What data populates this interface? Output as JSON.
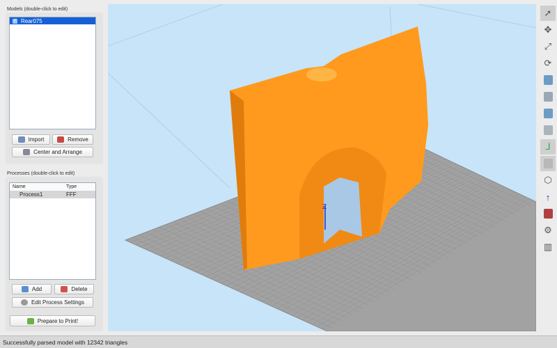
{
  "models": {
    "title": "Models (double-click to edit)",
    "items": [
      {
        "name": "Rear075",
        "checked": true
      }
    ],
    "import": "Import",
    "remove": "Remove",
    "center": "Center and Arrange"
  },
  "processes": {
    "title": "Processes (double-click to edit)",
    "columns": [
      "Name",
      "Type"
    ],
    "rows": [
      {
        "name": "Process1",
        "type": "FFF"
      }
    ],
    "add": "Add",
    "delete": "Delete",
    "edit": "Edit Process Settings",
    "prepare": "Prepare to Print!"
  },
  "viewport": {
    "axis_label": "Z",
    "model_color": "#ff9a1e",
    "bed_color": "#a0a0a0",
    "background": "#c8e4f8"
  },
  "toolbar": [
    "select-icon",
    "move-icon",
    "scale-icon",
    "rotate-icon",
    "view-top-icon",
    "view-front-icon",
    "view-side-icon",
    "view-iso-icon",
    "axes-icon",
    "solid-view-icon",
    "wireframe-view-icon",
    "z-axis-icon",
    "cross-section-icon",
    "settings-icon",
    "print-preview-icon"
  ],
  "status": "Successfully parsed model with 12342 triangles"
}
